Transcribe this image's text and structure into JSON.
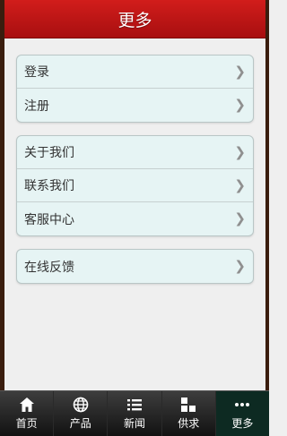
{
  "header": {
    "title": "更多"
  },
  "groups": [
    {
      "items": [
        {
          "label": "登录"
        },
        {
          "label": "注册"
        }
      ]
    },
    {
      "items": [
        {
          "label": "关于我们"
        },
        {
          "label": "联系我们"
        },
        {
          "label": "客服中心"
        }
      ]
    },
    {
      "items": [
        {
          "label": "在线反馈"
        }
      ]
    }
  ],
  "chevron": "❯",
  "tabs": [
    {
      "label": "首页",
      "icon": "home-icon"
    },
    {
      "label": "产品",
      "icon": "globe-icon"
    },
    {
      "label": "新闻",
      "icon": "list-icon"
    },
    {
      "label": "供求",
      "icon": "blocks-icon"
    },
    {
      "label": "更多",
      "icon": "more-dots-icon",
      "active": true
    }
  ],
  "colors": {
    "header": "#c41a19",
    "tabbar": "#1f1f1f",
    "active_tab": "#0d2a22",
    "row_bg": "#e6f4f4"
  }
}
